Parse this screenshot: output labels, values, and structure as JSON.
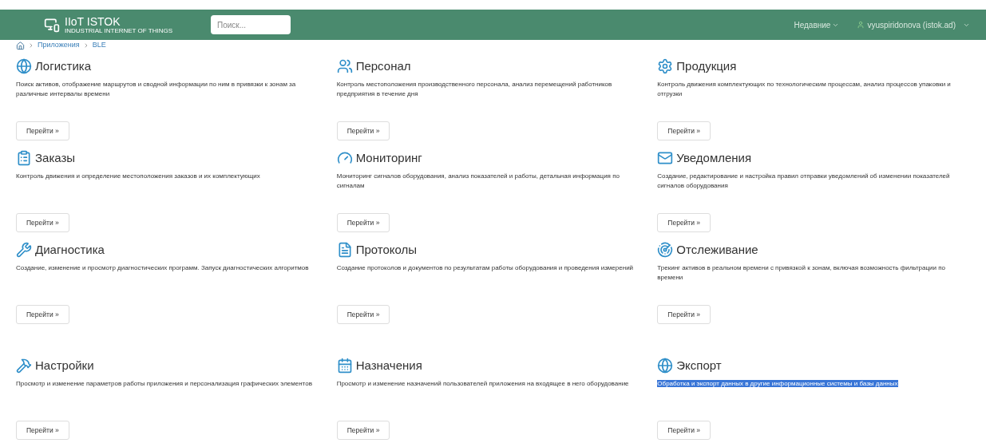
{
  "header": {
    "logo_title": "IIoT ISTOK",
    "logo_subtitle": "INDUSTRIAL INTERNET OF THINGS",
    "search": {
      "placeholder": "Поиск..."
    },
    "recent_menu": "Недавние",
    "user_menu": "vyuspiridonova (istok.ad)"
  },
  "breadcrumb": [
    "Приложения",
    "BLE"
  ],
  "cards": [
    {
      "title": "Логистика",
      "description": "Поиск активов, отображение маршрутов и сводной информации по ним в привязки к зонам за различные интервалы времени",
      "button": "Перейти »",
      "highlighted": false
    },
    {
      "title": "Персонал",
      "description": "Контроль местоположения производственного персонала, анализ перемещений работников предприятия в течение дня",
      "button": "Перейти »",
      "highlighted": false
    },
    {
      "title": "Продукция",
      "description": "Контроль движения комплектующих по технологическим процессам, анализ процессов упаковки и отгрузки",
      "button": "Перейти »",
      "highlighted": false
    },
    {
      "title": "Заказы",
      "description": "Контроль движения и определение местоположения заказов и их комплектующих",
      "button": "Перейти »",
      "highlighted": false
    },
    {
      "title": "Мониторинг",
      "description": "Мониторинг сигналов оборудования, анализ показателей и работы, детальная информация по сигналам",
      "button": "Перейти »",
      "highlighted": false
    },
    {
      "title": "Уведомления",
      "description": "Создание, редактирование и настройка правил отправки уведомлений об изменении показателей сигналов оборудования",
      "button": "Перейти »",
      "highlighted": false
    },
    {
      "title": "Диагностика",
      "description": "Создание, изменение и просмотр диагностических программ. Запуск диагностических алгоритмов",
      "button": "Перейти »",
      "highlighted": false
    },
    {
      "title": "Протоколы",
      "description": "Создание протоколов и документов по результатам работы оборудования и проведения измерений",
      "button": "Перейти »",
      "highlighted": false
    },
    {
      "title": "Отслеживание",
      "description": "Трекинг активов в реальном времени с привязкой к зонам, включая возможность фильтрации по времени",
      "button": "Перейти »",
      "highlighted": false
    },
    {
      "title": "Настройки",
      "description": "Просмотр и изменение параметров работы приложения и персонализация графических элементов",
      "button": "Перейти »",
      "highlighted": false
    },
    {
      "title": "Назначения",
      "description": "Просмотр и изменение назначений пользователей приложения на входящее в него оборудование",
      "button": "Перейти »",
      "highlighted": false
    },
    {
      "title": "Экспорт",
      "description": "Обработка и экспорт данных в другие информационные системы и базы данных",
      "button": "Перейти »",
      "highlighted": true
    }
  ]
}
